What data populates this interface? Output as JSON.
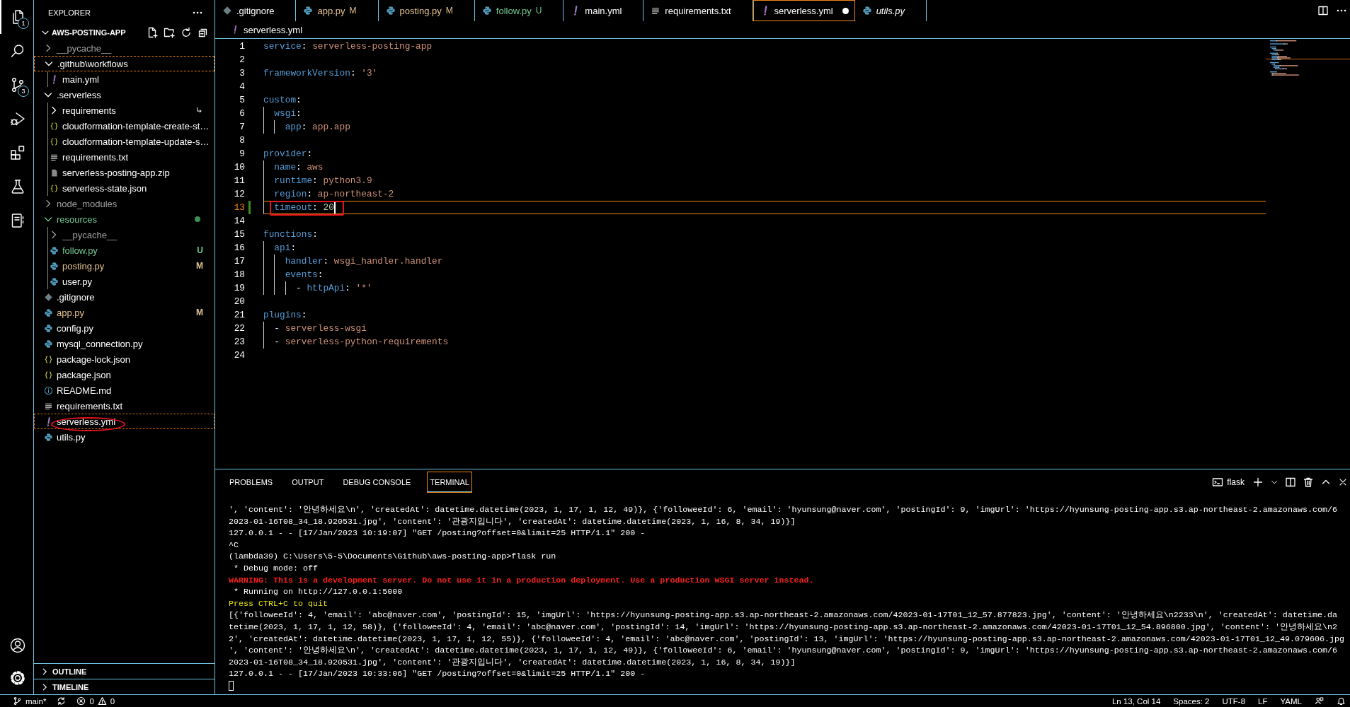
{
  "activity_bar": {
    "items": [
      {
        "kind": "explorer",
        "badge": "1",
        "selected": true
      },
      {
        "kind": "search",
        "selected": false
      },
      {
        "kind": "source-control",
        "badge": "3",
        "selected": false
      },
      {
        "kind": "run-debug",
        "selected": false
      },
      {
        "kind": "extensions",
        "selected": false
      },
      {
        "kind": "testing",
        "selected": false
      },
      {
        "kind": "notebook",
        "selected": false
      }
    ],
    "bottom_items": [
      {
        "kind": "account"
      },
      {
        "kind": "settings"
      }
    ]
  },
  "sidebar": {
    "title": "EXPLORER",
    "section": {
      "title": "AWS-POSTING-APP",
      "expanded": true
    },
    "tree": [
      {
        "label": "__pycache__",
        "kind": "folder",
        "color": "#a0a0a0",
        "expanded": false,
        "has_changes": false,
        "selected": false,
        "focused": false,
        "circled": false
      },
      {
        "label": ".github\\workflows",
        "kind": "folder",
        "color": "#ffffff",
        "expanded": true,
        "has_changes": false,
        "selected": false,
        "focused": true,
        "circled": false,
        "children": [
          {
            "label": "main.yml",
            "kind": "yaml",
            "color": "#ffffff",
            "selected": false,
            "focused": false,
            "circled": false
          }
        ]
      },
      {
        "label": ".serverless",
        "kind": "folder",
        "color": "#ffffff",
        "expanded": true,
        "has_changes": false,
        "selected": false,
        "focused": false,
        "circled": false,
        "children": [
          {
            "label": "requirements",
            "kind": "linked-folder",
            "color": "#ffffff",
            "expanded": false,
            "has_changes": false,
            "selected": false,
            "focused": false,
            "circled": false
          },
          {
            "label": "cloudformation-template-create-st…",
            "kind": "json",
            "color": "#ffffff",
            "selected": false,
            "focused": false,
            "circled": false
          },
          {
            "label": "cloudformation-template-update-s…",
            "kind": "json",
            "color": "#ffffff",
            "selected": false,
            "focused": false,
            "circled": false
          },
          {
            "label": "requirements.txt",
            "kind": "text",
            "color": "#ffffff",
            "selected": false,
            "focused": false,
            "circled": false
          },
          {
            "label": "serverless-posting-app.zip",
            "kind": "archive",
            "color": "#ffffff",
            "selected": false,
            "focused": false,
            "circled": false
          },
          {
            "label": "serverless-state.json",
            "kind": "json",
            "color": "#ffffff",
            "selected": false,
            "focused": false,
            "circled": false
          }
        ]
      },
      {
        "label": "node_modules",
        "kind": "folder",
        "color": "#a0a0a0",
        "expanded": false,
        "has_changes": false,
        "selected": false,
        "focused": false,
        "circled": false
      },
      {
        "label": "resources",
        "kind": "folder",
        "color": "#73c991",
        "expanded": true,
        "has_changes": true,
        "selected": false,
        "focused": false,
        "circled": false,
        "children": [
          {
            "label": "__pycache__",
            "kind": "folder",
            "color": "#a0a0a0",
            "expanded": false,
            "has_changes": false,
            "selected": false,
            "focused": false,
            "circled": false
          },
          {
            "label": "follow.py",
            "kind": "python",
            "color": "#73c991",
            "badge": "U",
            "selected": false,
            "focused": false,
            "circled": false
          },
          {
            "label": "posting.py",
            "kind": "python",
            "color": "#e2c08d",
            "badge": "M",
            "selected": false,
            "focused": false,
            "circled": false
          },
          {
            "label": "user.py",
            "kind": "python",
            "color": "#ffffff",
            "selected": false,
            "focused": false,
            "circled": false
          }
        ]
      },
      {
        "label": ".gitignore",
        "kind": "gitignore",
        "color": "#ffffff",
        "selected": false,
        "focused": false,
        "circled": false
      },
      {
        "label": "app.py",
        "kind": "python",
        "color": "#e2c08d",
        "badge": "M",
        "selected": false,
        "focused": false,
        "circled": false
      },
      {
        "label": "config.py",
        "kind": "python",
        "color": "#ffffff",
        "selected": false,
        "focused": false,
        "circled": false
      },
      {
        "label": "mysql_connection.py",
        "kind": "python",
        "color": "#ffffff",
        "selected": false,
        "focused": false,
        "circled": false
      },
      {
        "label": "package-lock.json",
        "kind": "json",
        "color": "#ffffff",
        "selected": false,
        "focused": false,
        "circled": false
      },
      {
        "label": "package.json",
        "kind": "json",
        "color": "#ffffff",
        "selected": false,
        "focused": false,
        "circled": false
      },
      {
        "label": "README.md",
        "kind": "info",
        "color": "#ffffff",
        "selected": false,
        "focused": false,
        "circled": false
      },
      {
        "label": "requirements.txt",
        "kind": "text",
        "color": "#ffffff",
        "selected": false,
        "focused": false,
        "circled": false
      },
      {
        "label": "serverless.yml",
        "kind": "yaml",
        "color": "#ffffff",
        "selected": true,
        "focused": false,
        "circled": true
      },
      {
        "label": "utils.py",
        "kind": "python",
        "color": "#ffffff",
        "selected": false,
        "focused": false,
        "circled": false
      }
    ],
    "bottom_sections": [
      {
        "title": "OUTLINE",
        "expanded": false
      },
      {
        "title": "TIMELINE",
        "expanded": false
      }
    ]
  },
  "tabs": [
    {
      "label": ".gitignore",
      "kind": "gitignore",
      "color": "#ffffff",
      "selected": false,
      "dirty": false,
      "preview": false
    },
    {
      "label": "app.py",
      "kind": "python",
      "color": "#e2c08d",
      "badge": "M",
      "selected": false,
      "dirty": false,
      "preview": false
    },
    {
      "label": "posting.py",
      "kind": "python",
      "color": "#e2c08d",
      "badge": "M",
      "selected": false,
      "dirty": false,
      "preview": false
    },
    {
      "label": "follow.py",
      "kind": "python",
      "color": "#73c991",
      "badge": "U",
      "selected": false,
      "dirty": false,
      "preview": false
    },
    {
      "label": "main.yml",
      "kind": "yaml",
      "color": "#ffffff",
      "selected": false,
      "dirty": false,
      "preview": false
    },
    {
      "label": "requirements.txt",
      "kind": "text",
      "color": "#ffffff",
      "selected": false,
      "dirty": false,
      "preview": false
    },
    {
      "label": "serverless.yml",
      "kind": "yaml",
      "color": "#ffffff",
      "selected": true,
      "dirty": true,
      "preview": false
    },
    {
      "label": "utils.py",
      "kind": "python",
      "color": "#ffffff",
      "selected": false,
      "dirty": false,
      "preview": true
    }
  ],
  "breadcrumb": {
    "kind": "yaml",
    "label": "serverless.yml"
  },
  "editor": {
    "lines": [
      {
        "number": "1",
        "tokens": [
          {
            "kind": "key",
            "text": "service"
          },
          {
            "kind": "punct",
            "text": ": "
          },
          {
            "kind": "string",
            "text": "serverless-posting-app"
          }
        ],
        "active": false,
        "modified": false,
        "circled": false
      },
      {
        "number": "2",
        "active": false,
        "modified": false,
        "circled": false
      },
      {
        "number": "3",
        "tokens": [
          {
            "kind": "key",
            "text": "frameworkVersion"
          },
          {
            "kind": "punct",
            "text": ": "
          },
          {
            "kind": "string",
            "text": "'3'"
          }
        ],
        "active": false,
        "modified": false,
        "circled": false
      },
      {
        "number": "4",
        "active": false,
        "modified": false,
        "circled": false
      },
      {
        "number": "5",
        "tokens": [
          {
            "kind": "key",
            "text": "custom"
          },
          {
            "kind": "punct",
            "text": ":"
          }
        ],
        "active": false,
        "modified": false,
        "circled": false,
        "children": [
          {
            "number": "6",
            "tokens": [
              {
                "kind": "key",
                "text": "wsgi"
              },
              {
                "kind": "punct",
                "text": ":"
              }
            ],
            "active": false,
            "modified": false,
            "circled": false,
            "children": [
              {
                "number": "7",
                "tokens": [
                  {
                    "kind": "key",
                    "text": "app"
                  },
                  {
                    "kind": "punct",
                    "text": ": "
                  },
                  {
                    "kind": "string",
                    "text": "app.app"
                  }
                ],
                "active": false,
                "modified": false,
                "circled": false
              }
            ]
          }
        ]
      },
      {
        "number": "8",
        "active": false,
        "modified": false,
        "circled": false
      },
      {
        "number": "9",
        "tokens": [
          {
            "kind": "key",
            "text": "provider"
          },
          {
            "kind": "punct",
            "text": ":"
          }
        ],
        "active": false,
        "modified": false,
        "circled": false,
        "children": [
          {
            "number": "10",
            "tokens": [
              {
                "kind": "key",
                "text": "name"
              },
              {
                "kind": "punct",
                "text": ": "
              },
              {
                "kind": "string",
                "text": "aws"
              }
            ],
            "active": false,
            "modified": false,
            "circled": false
          },
          {
            "number": "11",
            "tokens": [
              {
                "kind": "key",
                "text": "runtime"
              },
              {
                "kind": "punct",
                "text": ": "
              },
              {
                "kind": "string",
                "text": "python3.9"
              }
            ],
            "active": false,
            "modified": false,
            "circled": false
          },
          {
            "number": "12",
            "tokens": [
              {
                "kind": "key",
                "text": "region"
              },
              {
                "kind": "punct",
                "text": ": "
              },
              {
                "kind": "string",
                "text": "ap-northeast-2"
              }
            ],
            "active": false,
            "modified": false,
            "circled": false
          },
          {
            "number": "13",
            "tokens": [
              {
                "kind": "key",
                "text": "timeout"
              },
              {
                "kind": "punct",
                "text": ": "
              },
              {
                "kind": "number",
                "text": "20"
              }
            ],
            "active": true,
            "modified": true,
            "circled": true
          }
        ]
      },
      {
        "number": "14",
        "active": false,
        "modified": false,
        "circled": false
      },
      {
        "number": "15",
        "tokens": [
          {
            "kind": "key",
            "text": "functions"
          },
          {
            "kind": "punct",
            "text": ":"
          }
        ],
        "active": false,
        "modified": false,
        "circled": false,
        "children": [
          {
            "number": "16",
            "tokens": [
              {
                "kind": "key",
                "text": "api"
              },
              {
                "kind": "punct",
                "text": ":"
              }
            ],
            "active": false,
            "modified": false,
            "circled": false,
            "children": [
              {
                "number": "17",
                "tokens": [
                  {
                    "kind": "key",
                    "text": "handler"
                  },
                  {
                    "kind": "punct",
                    "text": ": "
                  },
                  {
                    "kind": "string",
                    "text": "wsgi_handler.handler"
                  }
                ],
                "active": false,
                "modified": false,
                "circled": false
              },
              {
                "number": "18",
                "tokens": [
                  {
                    "kind": "key",
                    "text": "events"
                  },
                  {
                    "kind": "punct",
                    "text": ":"
                  }
                ],
                "active": false,
                "modified": false,
                "circled": false,
                "children": [
                  {
                    "number": "19",
                    "tokens": [
                      {
                        "kind": "punct",
                        "text": "- "
                      },
                      {
                        "kind": "key",
                        "text": "httpApi"
                      },
                      {
                        "kind": "punct",
                        "text": ": "
                      },
                      {
                        "kind": "string",
                        "text": "'*'"
                      }
                    ],
                    "active": false,
                    "modified": false,
                    "circled": false
                  }
                ]
              }
            ]
          }
        ]
      },
      {
        "number": "20",
        "active": false,
        "modified": false,
        "circled": false
      },
      {
        "number": "21",
        "tokens": [
          {
            "kind": "key",
            "text": "plugins"
          },
          {
            "kind": "punct",
            "text": ":"
          }
        ],
        "active": false,
        "modified": false,
        "circled": false,
        "children": [
          {
            "number": "22",
            "tokens": [
              {
                "kind": "punct",
                "text": "- "
              },
              {
                "kind": "string",
                "text": "serverless-wsgi"
              }
            ],
            "active": false,
            "modified": false,
            "circled": false
          },
          {
            "number": "23",
            "tokens": [
              {
                "kind": "punct",
                "text": "- "
              },
              {
                "kind": "string",
                "text": "serverless-python-requirements"
              }
            ],
            "active": false,
            "modified": false,
            "circled": false
          }
        ]
      },
      {
        "number": "24",
        "active": false,
        "modified": false,
        "circled": false
      }
    ]
  },
  "panel": {
    "tabs": [
      {
        "label": "PROBLEMS",
        "selected": false
      },
      {
        "label": "OUTPUT",
        "selected": false
      },
      {
        "label": "DEBUG CONSOLE",
        "selected": false
      },
      {
        "label": "TERMINAL",
        "selected": true
      }
    ],
    "terminal": {
      "shell": "flask",
      "cursor": true,
      "lines": [
        {
          "kind": "output",
          "text": "', 'content': '안녕하세요\\n', 'createdAt': datetime.datetime(2023, 1, 17, 1, 12, 49)}, {'followeeId': 6, 'email': 'hyunsung@naver.com', 'postingId': 9, 'imgUrl': 'https://hyunsung-posting-app.s3.ap-northeast-2.amazonaws.com/6"
        },
        {
          "kind": "output",
          "text": "2023-01-16T08_34_18.920531.jpg', 'content': '관광지입니다', 'createdAt': datetime.datetime(2023, 1, 16, 8, 34, 19)}]"
        },
        {
          "kind": "output",
          "text": "127.0.0.1 - - [17/Jan/2023 10:19:07] \"GET /posting?offset=0&limit=25 HTTP/1.1\" 200 -"
        },
        {
          "kind": "output",
          "text": "^C"
        },
        {
          "kind": "output",
          "text": "(lambda39) C:\\Users\\5-5\\Documents\\Github\\aws-posting-app>flask run"
        },
        {
          "kind": "output",
          "text": " * Debug mode: off"
        },
        {
          "kind": "error",
          "text": "WARNING: This is a development server. Do not use it in a production deployment. Use a production WSGI server instead."
        },
        {
          "kind": "output",
          "text": " * Running on http://127.0.0.1:5000"
        },
        {
          "kind": "notice",
          "text": "Press CTRL+C to quit"
        },
        {
          "kind": "output",
          "text": "[{'followeeId': 4, 'email': 'abc@naver.com', 'postingId': 15, 'imgUrl': 'https://hyunsung-posting-app.s3.ap-northeast-2.amazonaws.com/42023-01-17T01_12_57.877823.jpg', 'content': '안녕하세요\\n2233\\n', 'createdAt': datetime.da"
        },
        {
          "kind": "output",
          "text": "tetime(2023, 1, 17, 1, 12, 58)}, {'followeeId': 4, 'email': 'abc@naver.com', 'postingId': 14, 'imgUrl': 'https://hyunsung-posting-app.s3.ap-northeast-2.amazonaws.com/42023-01-17T01_12_54.896800.jpg', 'content': '안녕하세요\\n2"
        },
        {
          "kind": "output",
          "text": "2', 'createdAt': datetime.datetime(2023, 1, 17, 1, 12, 55)}, {'followeeId': 4, 'email': 'abc@naver.com', 'postingId': 13, 'imgUrl': 'https://hyunsung-posting-app.s3.ap-northeast-2.amazonaws.com/42023-01-17T01_12_49.079606.jpg"
        },
        {
          "kind": "output",
          "text": "', 'content': '안녕하세요\\n', 'createdAt': datetime.datetime(2023, 1, 17, 1, 12, 49)}, {'followeeId': 6, 'email': 'hyunsung@naver.com', 'postingId': 9, 'imgUrl': 'https://hyunsung-posting-app.s3.ap-northeast-2.amazonaws.com/6"
        },
        {
          "kind": "output",
          "text": "2023-01-16T08_34_18.920531.jpg', 'content': '관광지입니다', 'createdAt': datetime.datetime(2023, 1, 16, 8, 34, 19)}]"
        },
        {
          "kind": "output",
          "text": "127.0.0.1 - - [17/Jan/2023 10:33:06] \"GET /posting?offset=0&limit=25 HTTP/1.1\" 200 -"
        }
      ]
    }
  },
  "status_bar": {
    "branch": "main*",
    "errors": "0",
    "warnings": "0",
    "items": [
      "Ln 13, Col 14",
      "Spaces: 2",
      "UTF-8",
      "LF",
      "YAML"
    ]
  }
}
